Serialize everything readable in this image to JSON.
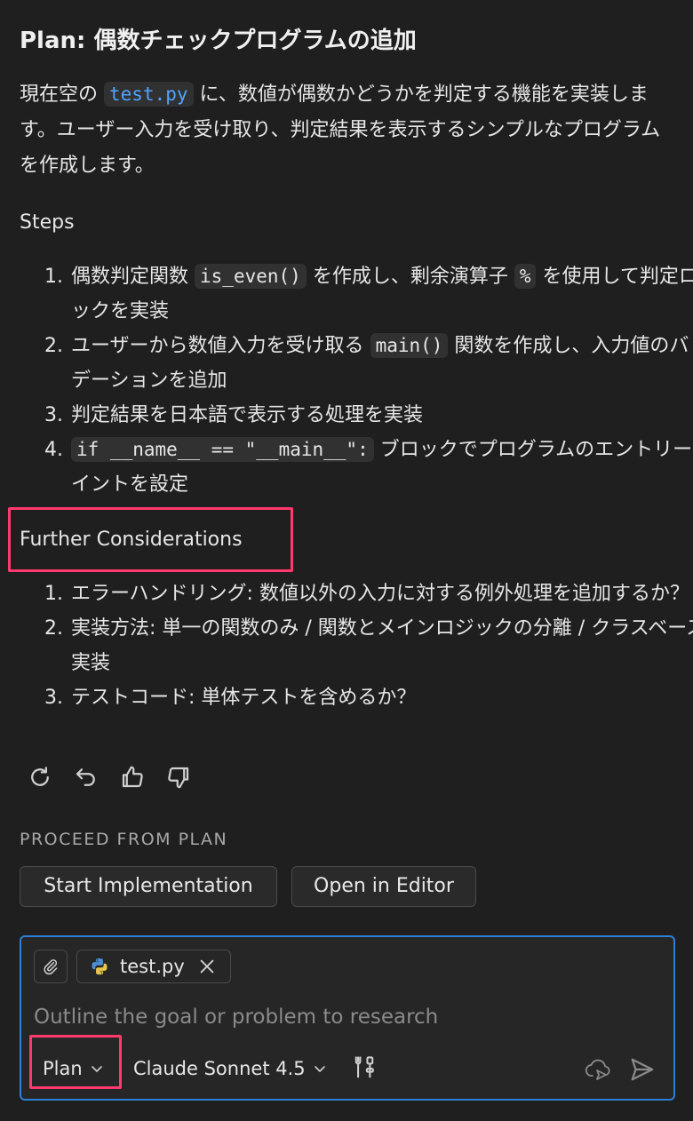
{
  "plan": {
    "title": "Plan: 偶数チェックプログラムの追加",
    "intro_before": "現在空の",
    "intro_file": "test.py",
    "intro_after": "に、数値が偶数かどうかを判定する機能を実装します。ユーザー入力を受け取り、判定結果を表示するシンプルなプログラムを作成します。"
  },
  "steps": {
    "heading": "Steps",
    "items": [
      {
        "a": "偶数判定関数",
        "code1": "is_even()",
        "b": "を作成し、剰余演算子",
        "code2": "%",
        "c": "を使用して判定ロジックを実装"
      },
      {
        "a": "ユーザーから数値入力を受け取る",
        "code1": "main()",
        "b": "関数を作成し、入力値のバリデーションを追加"
      },
      {
        "a": "判定結果を日本語で表示する処理を実装"
      },
      {
        "code1": "if __name__ == \"__main__\":",
        "b": "ブロックでプログラムのエントリーポイントを設定"
      }
    ]
  },
  "considerations": {
    "heading": "Further Considerations",
    "items": [
      "エラーハンドリング: 数値以外の入力に対する例外処理を追加するか？",
      "実装方法: 単一の関数のみ / 関数とメインロジックの分離 / クラスベースの実装",
      "テストコード: 単体テストを含めるか？"
    ]
  },
  "actions_icons": [
    "refresh-icon",
    "undo-icon",
    "thumbs-up-icon",
    "thumbs-down-icon"
  ],
  "proceed": {
    "label": "PROCEED FROM PLAN",
    "start_button": "Start Implementation",
    "open_button": "Open in Editor"
  },
  "composer": {
    "file_chip": "test.py",
    "placeholder": "Outline the goal or problem to research",
    "mode": "Plan",
    "model": "Claude Sonnet 4.5"
  },
  "colors": {
    "background": "#1f1f1f",
    "accent_blue": "#2f7fd8",
    "highlight_pink": "#ff3a6e",
    "file_link": "#4fa3ff"
  }
}
